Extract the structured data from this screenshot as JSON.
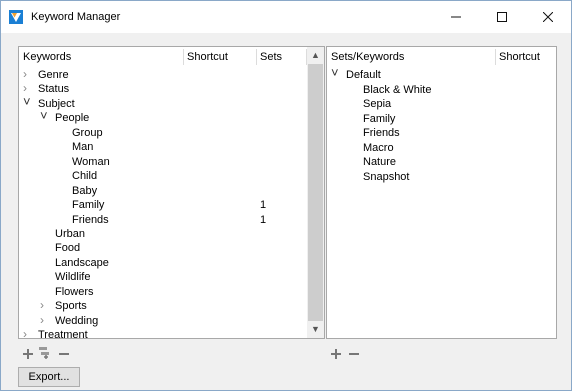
{
  "window": {
    "title": "Keyword Manager"
  },
  "left": {
    "headers": {
      "keywords": "Keywords",
      "shortcut": "Shortcut",
      "sets": "Sets"
    },
    "rows": [
      {
        "label": "Genre",
        "level": 0,
        "arrow": "collapsed",
        "sets": ""
      },
      {
        "label": "Status",
        "level": 0,
        "arrow": "collapsed",
        "sets": ""
      },
      {
        "label": "Subject",
        "level": 0,
        "arrow": "expanded",
        "sets": ""
      },
      {
        "label": "People",
        "level": 1,
        "arrow": "expanded",
        "sets": ""
      },
      {
        "label": "Group",
        "level": 2,
        "arrow": "none",
        "sets": ""
      },
      {
        "label": "Man",
        "level": 2,
        "arrow": "none",
        "sets": ""
      },
      {
        "label": "Woman",
        "level": 2,
        "arrow": "none",
        "sets": ""
      },
      {
        "label": "Child",
        "level": 2,
        "arrow": "none",
        "sets": ""
      },
      {
        "label": "Baby",
        "level": 2,
        "arrow": "none",
        "sets": ""
      },
      {
        "label": "Family",
        "level": 2,
        "arrow": "none",
        "sets": "1"
      },
      {
        "label": "Friends",
        "level": 2,
        "arrow": "none",
        "sets": "1"
      },
      {
        "label": "Urban",
        "level": 1,
        "arrow": "none",
        "sets": ""
      },
      {
        "label": "Food",
        "level": 1,
        "arrow": "none",
        "sets": ""
      },
      {
        "label": "Landscape",
        "level": 1,
        "arrow": "none",
        "sets": ""
      },
      {
        "label": "Wildlife",
        "level": 1,
        "arrow": "none",
        "sets": ""
      },
      {
        "label": "Flowers",
        "level": 1,
        "arrow": "none",
        "sets": ""
      },
      {
        "label": "Sports",
        "level": 1,
        "arrow": "collapsed",
        "sets": ""
      },
      {
        "label": "Wedding",
        "level": 1,
        "arrow": "collapsed",
        "sets": ""
      },
      {
        "label": "Treatment",
        "level": 0,
        "arrow": "collapsed",
        "sets": ""
      }
    ]
  },
  "right": {
    "headers": {
      "sets_keywords": "Sets/Keywords",
      "shortcut": "Shortcut"
    },
    "rows": [
      {
        "label": "Default",
        "level": 0,
        "arrow": "expanded"
      },
      {
        "label": "Black & White",
        "level": 1,
        "arrow": "none"
      },
      {
        "label": "Sepia",
        "level": 1,
        "arrow": "none"
      },
      {
        "label": "Family",
        "level": 1,
        "arrow": "none"
      },
      {
        "label": "Friends",
        "level": 1,
        "arrow": "none"
      },
      {
        "label": "Macro",
        "level": 1,
        "arrow": "none"
      },
      {
        "label": "Nature",
        "level": 1,
        "arrow": "none"
      },
      {
        "label": "Snapshot",
        "level": 1,
        "arrow": "none"
      }
    ]
  },
  "buttons": {
    "export": "Export..."
  },
  "icons": {
    "left_toolbar": [
      "add-icon",
      "add-sub-keyword-icon",
      "remove-icon"
    ],
    "right_toolbar": [
      "add-icon",
      "remove-icon"
    ]
  },
  "colors": {
    "app_icon": "#1a7fd4",
    "border": "#a8a8a8",
    "scroll_thumb": "#cdcdcd"
  }
}
